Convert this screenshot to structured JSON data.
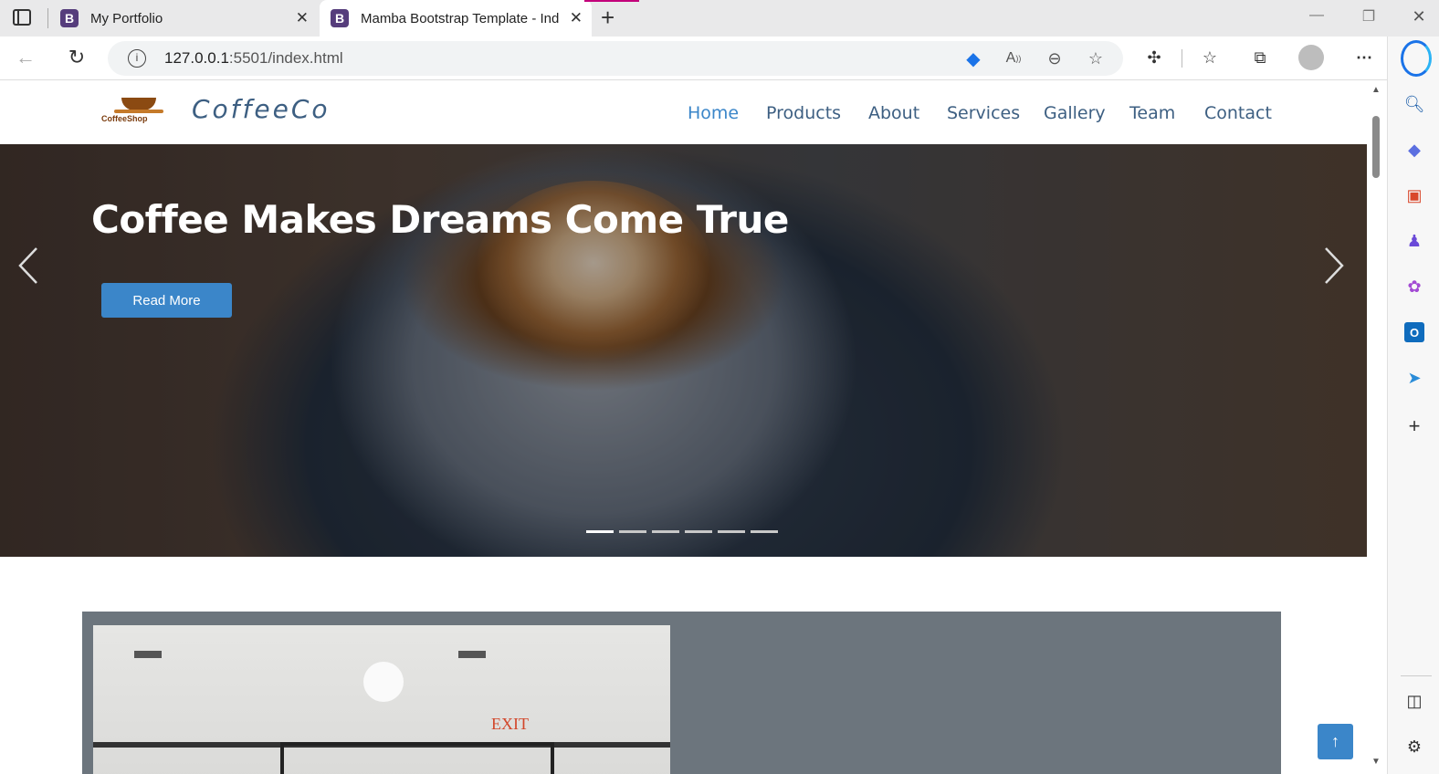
{
  "browser": {
    "tabs": [
      {
        "label": "My Portfolio",
        "favicon": "B"
      },
      {
        "label": "Mamba Bootstrap Template - Ind",
        "favicon": "B"
      }
    ],
    "new_tab": "+",
    "address": {
      "host": "127.0.0.1",
      "rest": ":5501/index.html"
    }
  },
  "site": {
    "logo_text": "CoffeeCo",
    "logo_badge": "CoffeeShop",
    "nav": [
      "Home",
      "Products",
      "About",
      "Services",
      "Gallery",
      "Team",
      "Contact"
    ],
    "active_nav": "Home",
    "hero": {
      "title": "Coffee Makes Dreams Come True",
      "button": "Read More",
      "slides": 6,
      "active_slide": 1
    },
    "about_image_sign": "EXIT",
    "scroll_top_icon": "↑"
  },
  "colors": {
    "accent": "#3b86c9",
    "nav_text": "#3d5f82",
    "about_bg": "#6c757d",
    "favicon": "#563d7c"
  }
}
